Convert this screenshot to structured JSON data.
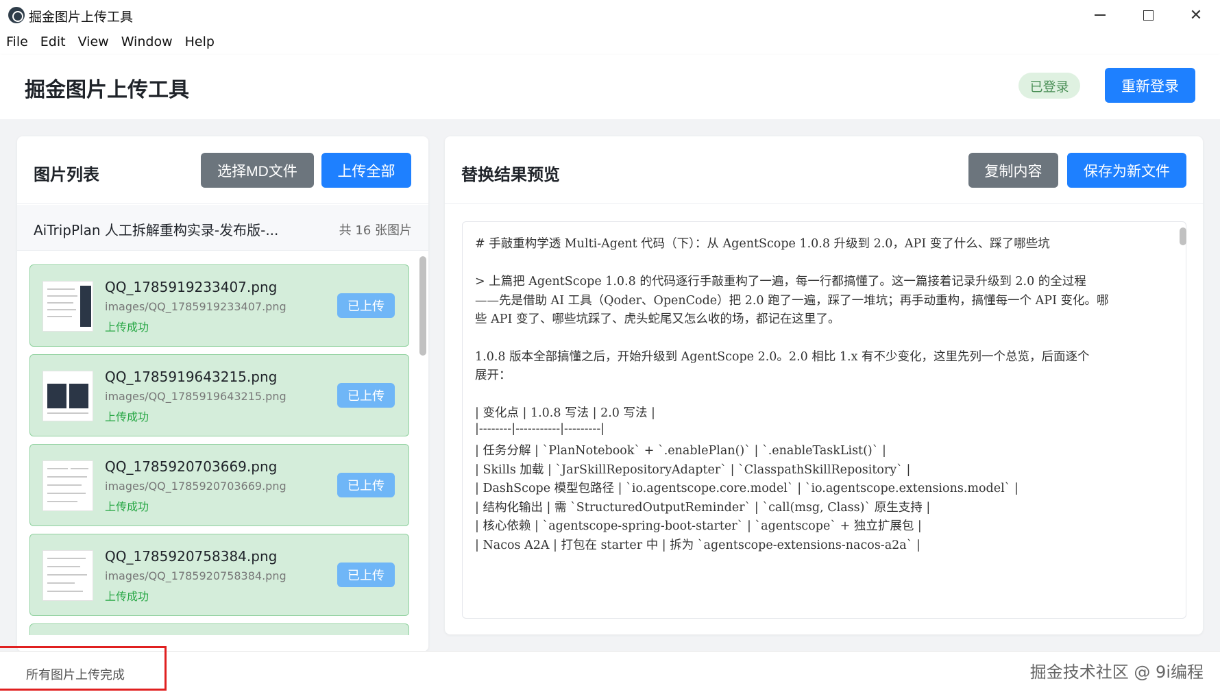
{
  "window": {
    "title": "掘金图片上传工具",
    "min_icon": "minimize-icon",
    "max_icon": "maximize-icon",
    "close_icon": "close-icon"
  },
  "menu": [
    "File",
    "Edit",
    "View",
    "Window",
    "Help"
  ],
  "header": {
    "title": "掘金图片上传工具",
    "status_badge": "已登录",
    "relogin_label": "重新登录"
  },
  "left_panel": {
    "title": "图片列表",
    "select_md_label": "选择MD文件",
    "upload_all_label": "上传全部",
    "file_name": "AiTripPlan 人工拆解重构实录-发布版-...",
    "file_count": "共 16 张图片",
    "images": [
      {
        "name": "QQ_1785919233407.png",
        "path": "images/QQ_1785919233407.png",
        "status": "上传成功",
        "button": "已上传"
      },
      {
        "name": "QQ_1785919643215.png",
        "path": "images/QQ_1785919643215.png",
        "status": "上传成功",
        "button": "已上传"
      },
      {
        "name": "QQ_1785920703669.png",
        "path": "images/QQ_1785920703669.png",
        "status": "上传成功",
        "button": "已上传"
      },
      {
        "name": "QQ_1785920758384.png",
        "path": "images/QQ_1785920758384.png",
        "status": "上传成功",
        "button": "已上传"
      }
    ]
  },
  "right_panel": {
    "title": "替换结果预览",
    "copy_label": "复制内容",
    "save_label": "保存为新文件",
    "lines": [
      "# 手敲重构学透 Multi-Agent 代码（下）：从 AgentScope 1.0.8 升级到 2.0，API 变了什么、踩了哪些坑",
      "> 上篇把 AgentScope 1.0.8 的代码逐行手敲重构了一遍，每一行都搞懂了。这一篇接着记录升级到 2.0 的全过程",
      "——先是借助 AI 工具（Qoder、OpenCode）把 2.0 跑了一遍，踩了一堆坑；再手动重构，搞懂每一个 API 变化。哪",
      "些 API 变了、哪些坑踩了、虎头蛇尾又怎么收的场，都记在这里了。",
      "1.0.8 版本全部搞懂之后，开始升级到 AgentScope 2.0。2.0 相比 1.x 有不少变化，这里先列一个总览，后面逐个",
      "展开：",
      "| 变化点 | 1.0.8 写法 | 2.0 写法 |",
      "|--------|-----------|---------|",
      "| 任务分解 | `PlanNotebook` + `.enablePlan()` | `.enableTaskList()` |",
      "| Skills 加载 | `JarSkillRepositoryAdapter` | `ClasspathSkillRepository` |",
      "| DashScope 模型包路径 | `io.agentscope.core.model` | `io.agentscope.extensions.model` |",
      "| 结构化输出 | 需 `StructuredOutputReminder` | `call(msg, Class)` 原生支持 |",
      "| 核心依赖 | `agentscope-spring-boot-starter` | `agentscope` + 独立扩展包 |",
      "| Nacos A2A | 打包在 starter 中 | 拆为 `agentscope-extensions-nacos-a2a` |"
    ]
  },
  "statusbar": {
    "message": "所有图片上传完成",
    "watermark": "掘金技术社区 @ 9i编程"
  }
}
